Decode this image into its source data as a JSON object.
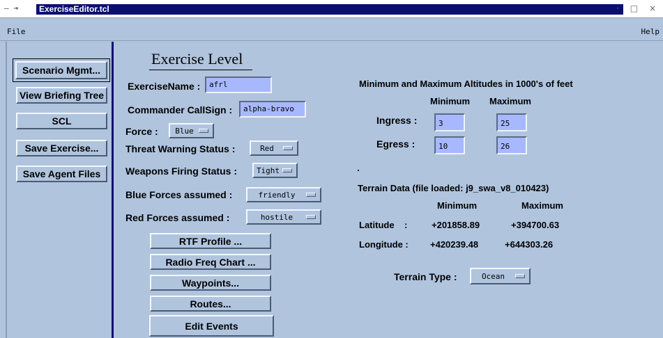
{
  "window": {
    "title": "ExerciseEditor.tcl",
    "sysmenu_glyph": "— ⇥",
    "controls": "· □ ×"
  },
  "menubar": {
    "file": "File",
    "help": "Help"
  },
  "sidebar": {
    "buttons": [
      {
        "id": "scenario",
        "label": "Scenario Mgmt..."
      },
      {
        "id": "briefing",
        "label": "View Briefing Tree"
      },
      {
        "id": "scl",
        "label": "SCL"
      },
      {
        "id": "save_exercise",
        "label": "Save Exercise..."
      },
      {
        "id": "save_agent",
        "label": "Save Agent Files"
      }
    ]
  },
  "exercise": {
    "heading": "Exercise Level",
    "name_label": "ExerciseName :",
    "name_value": "afrl",
    "callsign_label": "Commander CallSign :",
    "callsign_value": "alpha-bravo",
    "force_label": "Force :",
    "force_value": "Blue",
    "threat_label": "Threat Warning Status :",
    "threat_value": "Red",
    "weapons_label": "Weapons Firing Status :",
    "weapons_value": "Tight",
    "blue_label": "Blue Forces assumed :",
    "blue_value": "friendly",
    "red_label": "Red Forces assumed :",
    "red_value": "hostile"
  },
  "actions": {
    "rtf": "RTF Profile ...",
    "radio": "Radio Freq Chart ...",
    "waypoints": "Waypoints...",
    "routes": "Routes...",
    "events": "Edit Events"
  },
  "altitudes": {
    "title": "Minimum and Maximum Altitudes in 1000's of feet",
    "min_header": "Minimum",
    "max_header": "Maximum",
    "ingress_label": "Ingress :",
    "ingress_min": "3",
    "ingress_max": "25",
    "egress_label": "Egress :",
    "egress_min": "10",
    "egress_max": "26"
  },
  "terrain": {
    "title": "Terrain Data  (file loaded:  j9_swa_v8_010423)",
    "min_header": "Minimum",
    "max_header": "Maximum",
    "lat_label": "Latitude    :",
    "lat_min": "+201858.89",
    "lat_max": "+394700.63",
    "lon_label": "Longitude :",
    "lon_min": "+420239.48",
    "lon_max": "+644303.26",
    "type_label": "Terrain Type :",
    "type_value": "Ocean"
  },
  "colors": {
    "background": "#b0c4de",
    "entry": "#a8b8ff",
    "title_bar": "#0a0f6e"
  }
}
